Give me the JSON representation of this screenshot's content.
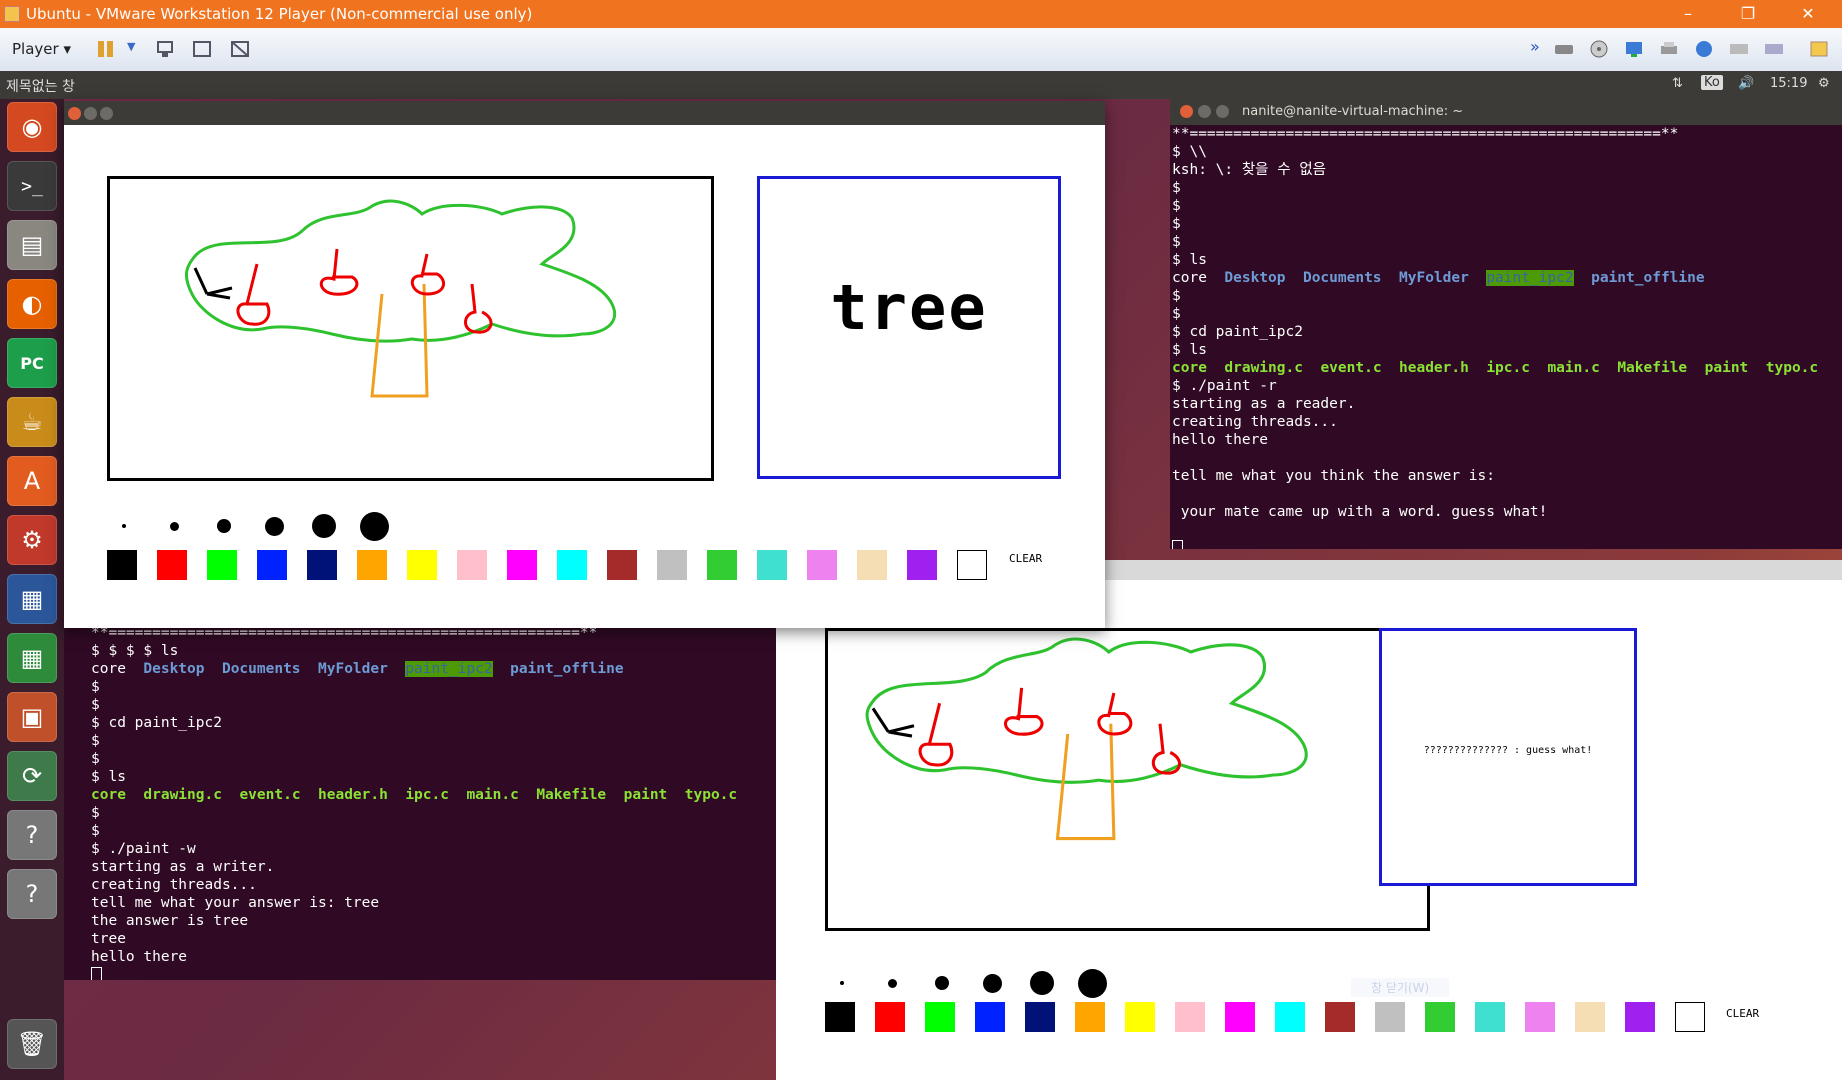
{
  "vm": {
    "title": "Ubuntu - VMware Workstation 12 Player (Non-commercial use only)",
    "player_menu": "Player",
    "controls": [
      "–",
      "❐",
      "✕"
    ]
  },
  "ubuntu_panel": {
    "window_title": "제목없는 창",
    "keyboard": "Ko",
    "time": "15:19"
  },
  "launcher": {
    "items": [
      "ubuntu-dash",
      "terminal",
      "files",
      "firefox",
      "pycharm",
      "teapot-app",
      "software-center",
      "system-settings",
      "libreoffice-writer",
      "libreoffice-calc",
      "libreoffice-impress",
      "software-updater",
      "unknown-app",
      "unknown-app",
      "trash"
    ]
  },
  "reader_terminal": {
    "title": "nanite@nanite-virtual-machine: ~",
    "lines": [
      [
        {
          "t": "**======================================================**"
        }
      ],
      [
        {
          "t": "$ \\\\"
        }
      ],
      [
        {
          "t": "ksh: \\: 찾을 수 없음"
        }
      ],
      [
        {
          "t": "$"
        }
      ],
      [
        {
          "t": "$"
        }
      ],
      [
        {
          "t": "$"
        }
      ],
      [
        {
          "t": "$"
        }
      ],
      [
        {
          "t": "$ ls"
        }
      ],
      [
        {
          "t": "core  "
        },
        {
          "t": "Desktop",
          "c": "t-blue"
        },
        {
          "t": "  "
        },
        {
          "t": "Documents",
          "c": "t-blue"
        },
        {
          "t": "  "
        },
        {
          "t": "MyFolder",
          "c": "t-blue"
        },
        {
          "t": "  "
        },
        {
          "t": "paint_ipc2",
          "c": "t-hl"
        },
        {
          "t": "  "
        },
        {
          "t": "paint_offline",
          "c": "t-blue"
        }
      ],
      [
        {
          "t": "$"
        }
      ],
      [
        {
          "t": "$"
        }
      ],
      [
        {
          "t": "$ cd paint_ipc2"
        }
      ],
      [
        {
          "t": "$ ls"
        }
      ],
      [
        {
          "t": "core",
          "c": "t-green"
        },
        {
          "t": "  "
        },
        {
          "t": "drawing.c",
          "c": "t-green"
        },
        {
          "t": "  "
        },
        {
          "t": "event.c",
          "c": "t-green"
        },
        {
          "t": "  "
        },
        {
          "t": "header.h",
          "c": "t-green"
        },
        {
          "t": "  "
        },
        {
          "t": "ipc.c",
          "c": "t-green"
        },
        {
          "t": "  "
        },
        {
          "t": "main.c",
          "c": "t-green"
        },
        {
          "t": "  "
        },
        {
          "t": "Makefile",
          "c": "t-green"
        },
        {
          "t": "  "
        },
        {
          "t": "paint",
          "c": "t-green"
        },
        {
          "t": "  "
        },
        {
          "t": "typo.c",
          "c": "t-green"
        }
      ],
      [
        {
          "t": "$ ./paint -r"
        }
      ],
      [
        {
          "t": "starting as a reader."
        }
      ],
      [
        {
          "t": "creating threads..."
        }
      ],
      [
        {
          "t": "hello there"
        }
      ],
      [
        {
          "t": ""
        }
      ],
      [
        {
          "t": "tell me what you think the answer is:"
        }
      ],
      [
        {
          "t": ""
        }
      ],
      [
        {
          "t": " your mate came up with a word. guess what!"
        }
      ],
      [
        {
          "t": ""
        }
      ],
      [
        {
          "t": "",
          "cursor": true
        }
      ]
    ]
  },
  "writer_terminal": {
    "lines": [
      [
        {
          "t": "**======================================================**"
        }
      ],
      [
        {
          "t": "$ $ $ $ ls"
        }
      ],
      [
        {
          "t": "core  "
        },
        {
          "t": "Desktop",
          "c": "t-blue"
        },
        {
          "t": "  "
        },
        {
          "t": "Documents",
          "c": "t-blue"
        },
        {
          "t": "  "
        },
        {
          "t": "MyFolder",
          "c": "t-blue"
        },
        {
          "t": "  "
        },
        {
          "t": "paint_ipc2",
          "c": "t-hl"
        },
        {
          "t": "  "
        },
        {
          "t": "paint_offline",
          "c": "t-blue"
        }
      ],
      [
        {
          "t": "$"
        }
      ],
      [
        {
          "t": "$"
        }
      ],
      [
        {
          "t": "$ cd paint_ipc2"
        }
      ],
      [
        {
          "t": "$"
        }
      ],
      [
        {
          "t": "$"
        }
      ],
      [
        {
          "t": "$ ls"
        }
      ],
      [
        {
          "t": "core",
          "c": "t-green"
        },
        {
          "t": "  "
        },
        {
          "t": "drawing.c",
          "c": "t-green"
        },
        {
          "t": "  "
        },
        {
          "t": "event.c",
          "c": "t-green"
        },
        {
          "t": "  "
        },
        {
          "t": "header.h",
          "c": "t-green"
        },
        {
          "t": "  "
        },
        {
          "t": "ipc.c",
          "c": "t-green"
        },
        {
          "t": "  "
        },
        {
          "t": "main.c",
          "c": "t-green"
        },
        {
          "t": "  "
        },
        {
          "t": "Makefile",
          "c": "t-green"
        },
        {
          "t": "  "
        },
        {
          "t": "paint",
          "c": "t-green"
        },
        {
          "t": "  "
        },
        {
          "t": "typo.c",
          "c": "t-green"
        }
      ],
      [
        {
          "t": "$"
        }
      ],
      [
        {
          "t": "$"
        }
      ],
      [
        {
          "t": "$ ./paint -w"
        }
      ],
      [
        {
          "t": "starting as a writer."
        }
      ],
      [
        {
          "t": "creating threads..."
        }
      ],
      [
        {
          "t": "tell me what your answer is: tree"
        }
      ],
      [
        {
          "t": "the answer is tree"
        }
      ],
      [
        {
          "t": "tree"
        }
      ],
      [
        {
          "t": "hello there"
        }
      ],
      [
        {
          "t": "",
          "cursor": true
        }
      ]
    ]
  },
  "writer_paint": {
    "word": "tree",
    "clear_label": "CLEAR"
  },
  "reader_paint": {
    "message": "?????????????? : guess what!",
    "clear_label": "CLEAR",
    "faded_label": "창 닫기(W)"
  },
  "palette": [
    "#000000",
    "#ff0000",
    "#00ff00",
    "#0022ff",
    "#001177",
    "#ffa500",
    "#ffff00",
    "#ffc0cb",
    "#ff00ff",
    "#00ffff",
    "#a52a2a",
    "#c0c0c0",
    "#32cd32",
    "#40e0d0",
    "#ee82ee",
    "#f5deb3",
    "#a020f0",
    "#ffffff"
  ],
  "brush_sizes": [
    1,
    2,
    3,
    4,
    5,
    6
  ]
}
